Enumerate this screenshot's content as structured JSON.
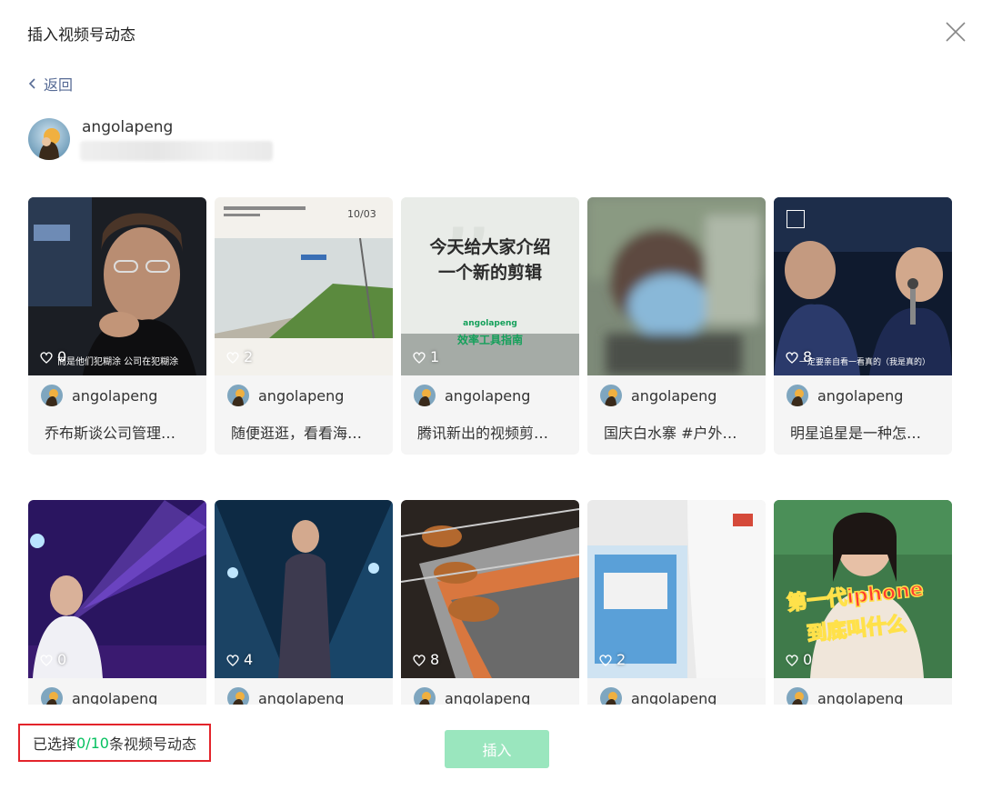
{
  "dialog": {
    "title": "插入视频号动态",
    "back_label": "返回"
  },
  "profile": {
    "name": "angolapeng"
  },
  "cards": [
    {
      "author": "angolapeng",
      "caption": "乔布斯谈公司管理…",
      "likes": "0",
      "thumb_title": "",
      "thumb_sub": "",
      "thumb_date": "",
      "overlay_text": "而是他们犯糊涂 公司在犯糊涂"
    },
    {
      "author": "angolapeng",
      "caption": "随便逛逛，看看海…",
      "likes": "2",
      "thumb_date": "10/03"
    },
    {
      "author": "angolapeng",
      "caption": "腾讯新出的视频剪…",
      "likes": "1",
      "thumb_title_1": "今天给大家介绍",
      "thumb_title_2": "一个新的剪辑",
      "thumb_sub_1": "angolapeng",
      "thumb_sub_2": "效率工具指南"
    },
    {
      "author": "angolapeng",
      "caption": "国庆白水寨 #户外…",
      "likes": ""
    },
    {
      "author": "angolapeng",
      "caption": "明星追星是一种怎…",
      "likes": "8",
      "overlay_text": "一定要亲自看一看真的（我是真的）"
    },
    {
      "author": "angolapeng",
      "caption": "",
      "likes": "0"
    },
    {
      "author": "angolapeng",
      "caption": "",
      "likes": "4"
    },
    {
      "author": "angolapeng",
      "caption": "",
      "likes": "8"
    },
    {
      "author": "angolapeng",
      "caption": "",
      "likes": "2"
    },
    {
      "author": "angolapeng",
      "caption": "",
      "likes": "0",
      "overlay_title_1": "第一代iphone",
      "overlay_title_2": "到底叫什么"
    }
  ],
  "footer": {
    "status_prefix": "已选择",
    "selected": "0/10",
    "status_suffix": "条视频号动态",
    "insert_label": "插入"
  },
  "colors": {
    "accent": "#07c160",
    "link": "#576b95",
    "highlight_border": "#e3242b",
    "insert_disabled": "#9ae6be"
  }
}
